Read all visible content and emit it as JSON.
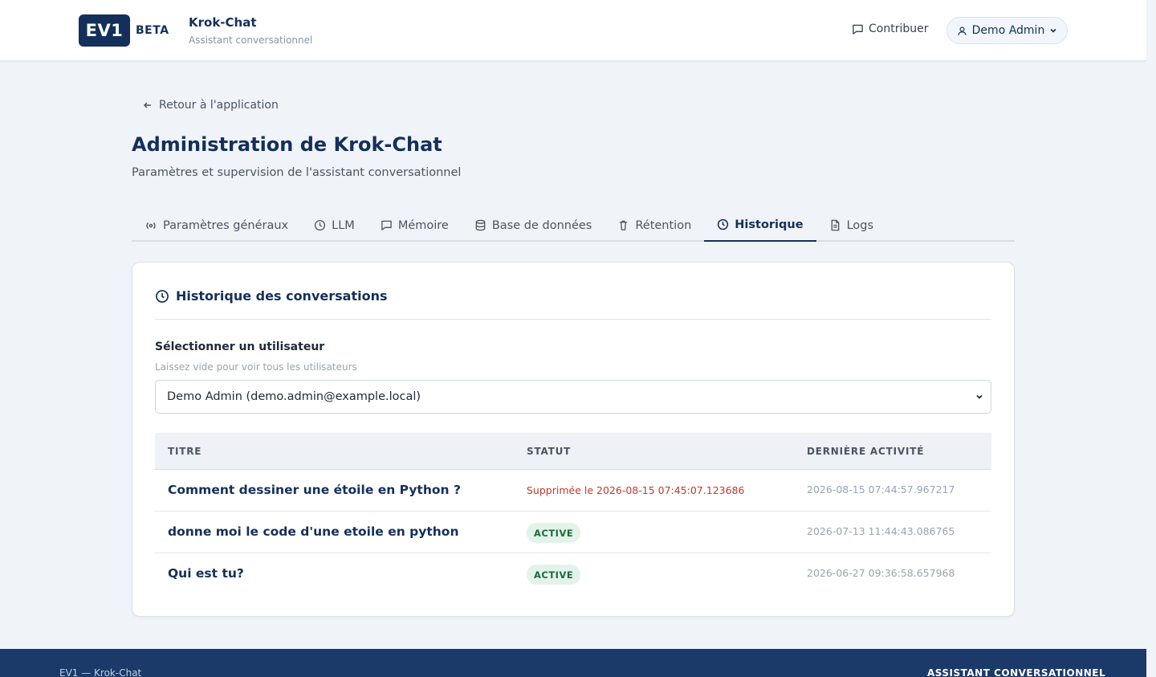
{
  "header": {
    "logo_text": "EV1",
    "logo_badge": "BETA",
    "app_title": "Krok-Chat",
    "app_subtitle": "Assistant conversationnel",
    "contribute_label": "Contribuer",
    "user_label": "Demo Admin"
  },
  "main": {
    "back_label": "Retour à l'application",
    "title": "Administration de Krok-Chat",
    "subtitle": "Paramètres et supervision de l'assistant conversationnel"
  },
  "tabs": [
    {
      "label": "Paramètres généraux",
      "icon": "broadcast-icon"
    },
    {
      "label": "LLM",
      "icon": "clock-icon"
    },
    {
      "label": "Mémoire",
      "icon": "message-icon"
    },
    {
      "label": "Base de données",
      "icon": "database-icon"
    },
    {
      "label": "Rétention",
      "icon": "trash-icon"
    },
    {
      "label": "Historique",
      "icon": "clock-icon",
      "active": true
    },
    {
      "label": "Logs",
      "icon": "document-icon"
    }
  ],
  "history": {
    "title": "Historique des conversations",
    "select_label": "Sélectionner un utilisateur",
    "select_hint": "Laissez vide pour voir tous les utilisateurs",
    "select_value": "Demo Admin (demo.admin@example.local)",
    "columns": [
      "TITRE",
      "STATUT",
      "DERNIÈRE ACTIVITÉ"
    ],
    "rows": [
      {
        "title": "Comment dessiner une étoile en Python ?",
        "status": "Supprimée le 2026-08-15 07:45:07.123686",
        "status_type": "deleted",
        "last_activity": "2026-08-15 07:44:57.967217"
      },
      {
        "title": "donne moi le code d'une etoile en python",
        "status": "ACTIVE",
        "status_type": "active",
        "last_activity": "2026-07-13 11:44:43.086765"
      },
      {
        "title": "Qui est tu?",
        "status": "ACTIVE",
        "status_type": "active",
        "last_activity": "2026-06-27 09:36:58.657968"
      }
    ]
  },
  "footer": {
    "left": "EV1 — Krok-Chat",
    "right": "ASSISTANT CONVERSATIONNEL"
  },
  "colors": {
    "brand": "#14305a",
    "footer": "#1b3a6a",
    "deleted": "#c0392b",
    "active_badge_bg": "#e3f3ea",
    "active_badge_text": "#1b6b3a"
  }
}
